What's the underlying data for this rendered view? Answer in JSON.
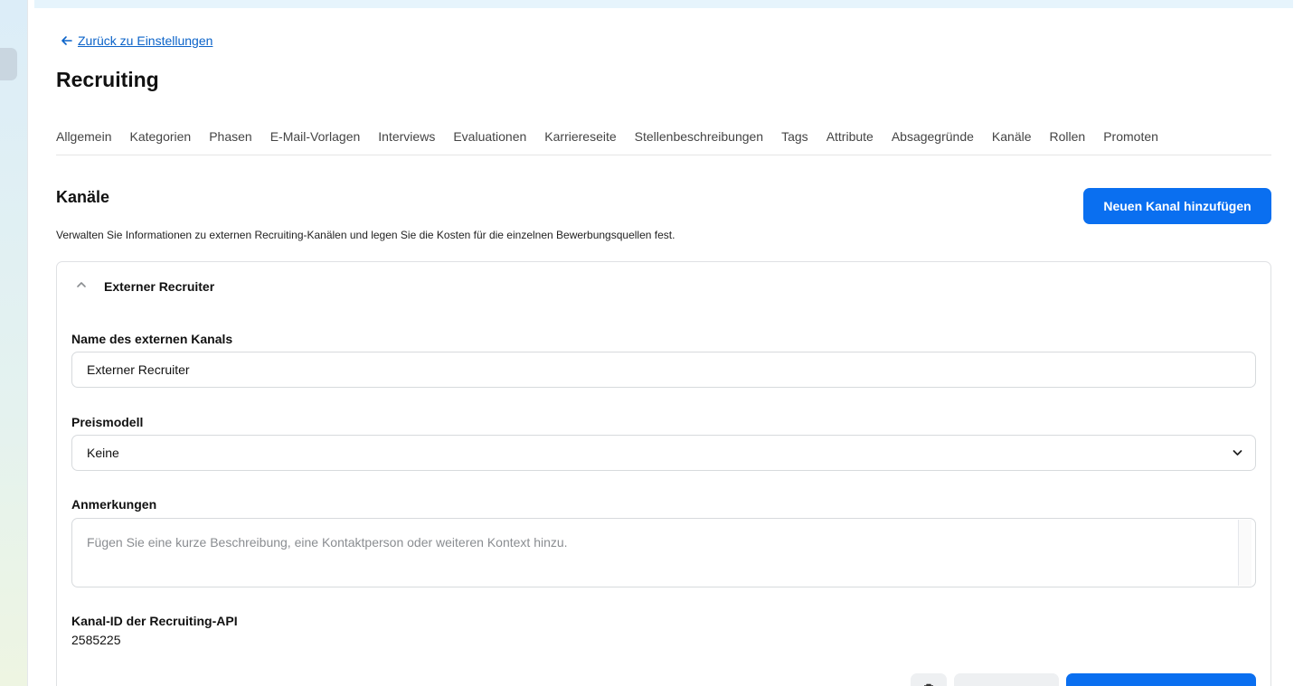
{
  "navigation": {
    "back_link": "Zurück zu Einstellungen"
  },
  "page": {
    "title": "Recruiting"
  },
  "tabs": [
    {
      "label": "Allgemein"
    },
    {
      "label": "Kategorien"
    },
    {
      "label": "Phasen"
    },
    {
      "label": "E-Mail-Vorlagen"
    },
    {
      "label": "Interviews"
    },
    {
      "label": "Evaluationen"
    },
    {
      "label": "Karriereseite"
    },
    {
      "label": "Stellenbeschreibungen"
    },
    {
      "label": "Tags"
    },
    {
      "label": "Attribute"
    },
    {
      "label": "Absagegründe"
    },
    {
      "label": "Kanäle"
    },
    {
      "label": "Rollen"
    },
    {
      "label": "Promoten"
    }
  ],
  "section": {
    "title": "Kanäle",
    "description": "Verwalten Sie Informationen zu externen Recruiting-Kanälen und legen Sie die Kosten für die einzelnen Bewerbungsquellen fest.",
    "add_button": "Neuen Kanal hinzufügen"
  },
  "channel_card": {
    "title": "Externer Recruiter",
    "name_label": "Name des externen Kanals",
    "name_value": "Externer Recruiter",
    "pricing_label": "Preismodell",
    "pricing_value": "Keine",
    "notes_label": "Anmerkungen",
    "notes_placeholder": "Fügen Sie eine kurze Beschreibung, eine Kontaktperson oder weiteren Kontext hinzu.",
    "api_id_label": "Kanal-ID der Recruiting-API",
    "api_id_value": "2585225"
  },
  "colors": {
    "accent": "#0a6ff0",
    "link": "#0b63c9",
    "border": "#d7dadd"
  },
  "icons": {
    "back": "arrow-left-icon",
    "collapse": "chevron-up-icon",
    "select": "chevron-down-icon",
    "delete": "trash-icon"
  }
}
